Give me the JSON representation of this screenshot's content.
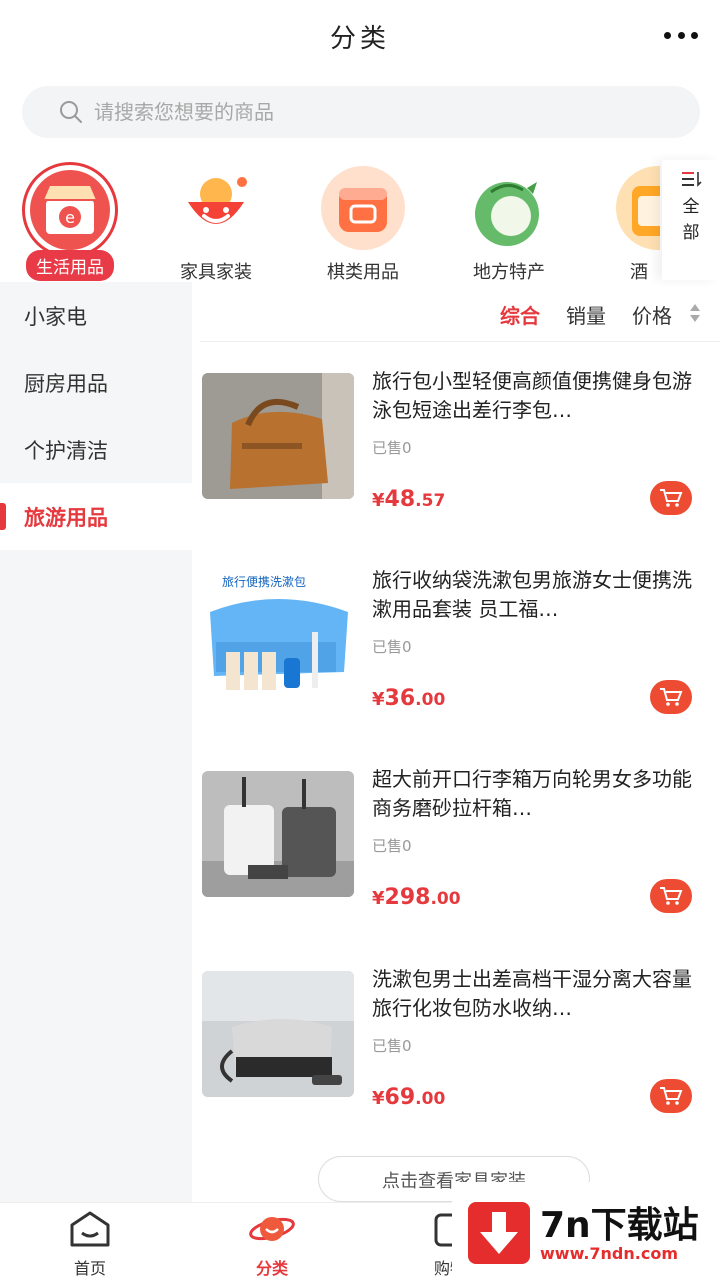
{
  "header": {
    "title": "分类",
    "more_icon": "more-dots-icon"
  },
  "search": {
    "placeholder": "请搜索您想要的商品",
    "icon": "search-icon"
  },
  "categories": [
    {
      "label": "生活用品",
      "active": true
    },
    {
      "label": "家具家装"
    },
    {
      "label": "棋类用品"
    },
    {
      "label": "地方特产"
    },
    {
      "label": "酒"
    }
  ],
  "all_button": {
    "label": "全部"
  },
  "sidebar": {
    "items": [
      {
        "label": "小家电"
      },
      {
        "label": "厨房用品"
      },
      {
        "label": "个护清洁"
      },
      {
        "label": "旅游用品",
        "active": true
      }
    ]
  },
  "sort": {
    "comprehensive": "综合",
    "sales": "销量",
    "price": "价格"
  },
  "products": [
    {
      "title": "旅行包小型轻便高颜值便携健身包游泳包短途出差行李包…",
      "sold": "已售0",
      "price_symbol": "¥",
      "price_int": "48",
      "price_dec": ".57"
    },
    {
      "title": "旅行收纳袋洗漱包男旅游女士便携洗漱用品套装 员工福…",
      "sold": "已售0",
      "price_symbol": "¥",
      "price_int": "36",
      "price_dec": ".00",
      "image_text": "旅行便携洗漱包"
    },
    {
      "title": "超大前开口行李箱万向轮男女多功能商务磨砂拉杆箱…",
      "sold": "已售0",
      "price_symbol": "¥",
      "price_int": "298",
      "price_dec": ".00"
    },
    {
      "title": "洗漱包男士出差高档干湿分离大容量旅行化妆包防水收纳…",
      "sold": "已售0",
      "price_symbol": "¥",
      "price_int": "69",
      "price_dec": ".00"
    }
  ],
  "more_link": "点击查看家具家装",
  "tabbar": {
    "home": "首页",
    "category": "分类",
    "cart": "购物"
  },
  "watermark": {
    "title": "7n下载站",
    "url": "www.7ndn.com"
  },
  "colors": {
    "accent": "#e5393e",
    "cart": "#ee4c32"
  }
}
